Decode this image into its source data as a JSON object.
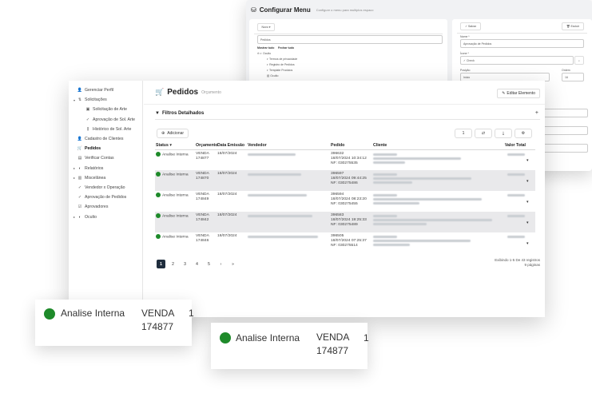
{
  "back_window": {
    "title": "Configurar Menu",
    "subtitle": "Configure o menu para multiplos espaco",
    "novo_label": "Novo",
    "search_value": "Pedidos",
    "expand_all": "Mostrar tudo",
    "collapse_all": "Fechar tudo",
    "tree": [
      "Oculto",
      "Termos de privacidade",
      "Registro de Pedidos",
      "Template Produtos",
      "Oculto"
    ],
    "salvar_label": "Salvar",
    "excluir_label": "Excluir",
    "field_nome_label": "Nome *",
    "field_nome_value": "Aprovação de Pedidos",
    "field_icone_label": "Ícone *",
    "field_icone_value": "Check",
    "field_posicao_label": "Posição",
    "field_posicao_value": "Inicio",
    "field_ordem_label": "Ordem",
    "field_ordem_value": "16"
  },
  "sidebar": {
    "items": [
      {
        "label": "Gerenciar Perfil",
        "icon": "user-icon",
        "glyph": "👤",
        "chevron": ""
      },
      {
        "label": "Solicitações",
        "icon": "list-icon",
        "glyph": "⇅",
        "chevron": "▾"
      },
      {
        "label": "Solicitação de Arte",
        "icon": "image-icon",
        "glyph": "▣",
        "chevron": "",
        "sub": true
      },
      {
        "label": "Aprovação de Sol. Arte",
        "icon": "check-icon",
        "glyph": "✓",
        "chevron": "",
        "sub": true
      },
      {
        "label": "Histórico de Sol. Arte",
        "icon": "chart-icon",
        "glyph": "⫼",
        "chevron": "",
        "sub": true
      },
      {
        "label": "Cadastro de Clientes",
        "icon": "user-icon",
        "glyph": "👤",
        "chevron": ""
      },
      {
        "label": "Pedidos",
        "icon": "cart-icon",
        "glyph": "🛒",
        "chevron": "",
        "active": true
      },
      {
        "label": "Verificar Contas",
        "icon": "money-icon",
        "glyph": "▤",
        "chevron": ""
      },
      {
        "label": "Relatórios",
        "icon": "circle-half-icon",
        "glyph": "◐",
        "chevron": "▸"
      },
      {
        "label": "Miscelânea",
        "icon": "box-icon",
        "glyph": "▥",
        "chevron": "▸"
      },
      {
        "label": "Vendedor x Operação",
        "icon": "check-icon",
        "glyph": "✓",
        "chevron": ""
      },
      {
        "label": "Aprovação de Pedidos",
        "icon": "check-icon",
        "glyph": "✓",
        "chevron": ""
      },
      {
        "label": "Aprovadores",
        "icon": "check-list-icon",
        "glyph": "☑",
        "chevron": ""
      },
      {
        "label": "Oculto",
        "icon": "circle-half-icon",
        "glyph": "◐",
        "chevron": "▸"
      }
    ]
  },
  "header": {
    "title": "Pedidos",
    "subtitle": "Orçamento",
    "edit_label": "Editar Elemento"
  },
  "filters": {
    "label": "Filtros Detalhados",
    "plus": "+"
  },
  "toolbar": {
    "add_label": "Adicionar",
    "count": "1",
    "refresh": "⇄",
    "download": "⤓",
    "settings": "⚙"
  },
  "table": {
    "columns": [
      "Status",
      "Orçamento",
      "Data Emissão",
      "Vendedor",
      "Pedido",
      "Cliente",
      "Valor Total"
    ],
    "rows": [
      {
        "status": "Analise Interna",
        "orc1": "VENDA",
        "orc2": "174877",
        "date": "18/07/2024",
        "pedido": "396632",
        "ped_date": "18/07/2024 10:34:12",
        "nf": "NF: 030275535",
        "shade": false
      },
      {
        "status": "Analise Interna",
        "orc1": "VENDA",
        "orc2": "174870",
        "date": "18/07/2024",
        "pedido": "396597",
        "ped_date": "18/07/2024 09:44:25",
        "nf": "NF: 030275486",
        "shade": true
      },
      {
        "status": "Analise Interna",
        "orc1": "VENDA",
        "orc2": "174849",
        "date": "18/07/2024",
        "pedido": "396594",
        "ped_date": "18/07/2024 08:23:20",
        "nf": "NF: 030275455",
        "shade": false
      },
      {
        "status": "Analise Interna",
        "orc1": "VENDA",
        "orc2": "174842",
        "date": "18/07/2024",
        "pedido": "396583",
        "ped_date": "18/07/2024 19:25:33",
        "nf": "NF: 030275489",
        "shade": true
      },
      {
        "status": "Analise Interna",
        "orc1": "VENDA",
        "orc2": "174846",
        "date": "18/07/2024",
        "pedido": "396505",
        "ped_date": "18/07/2024 07:25:37",
        "nf": "NF: 030275514",
        "shade": false
      }
    ]
  },
  "pagination": {
    "pages": [
      "1",
      "2",
      "3",
      "4",
      "5",
      "›",
      "»"
    ],
    "info_line1": "Exibindo 1-5 De 43 registros",
    "info_line2": "9 páginas"
  },
  "zoom_cards": [
    {
      "status": "Analise Interna",
      "orc1": "VENDA",
      "orc2": "174877",
      "cut": "1"
    },
    {
      "status": "Analise Interna",
      "orc1": "VENDA",
      "orc2": "174877",
      "cut": "1"
    }
  ],
  "colors": {
    "status_green": "#1e8a2a",
    "active_page": "#1f2d3d",
    "shade_row": "#e9e9eb"
  }
}
